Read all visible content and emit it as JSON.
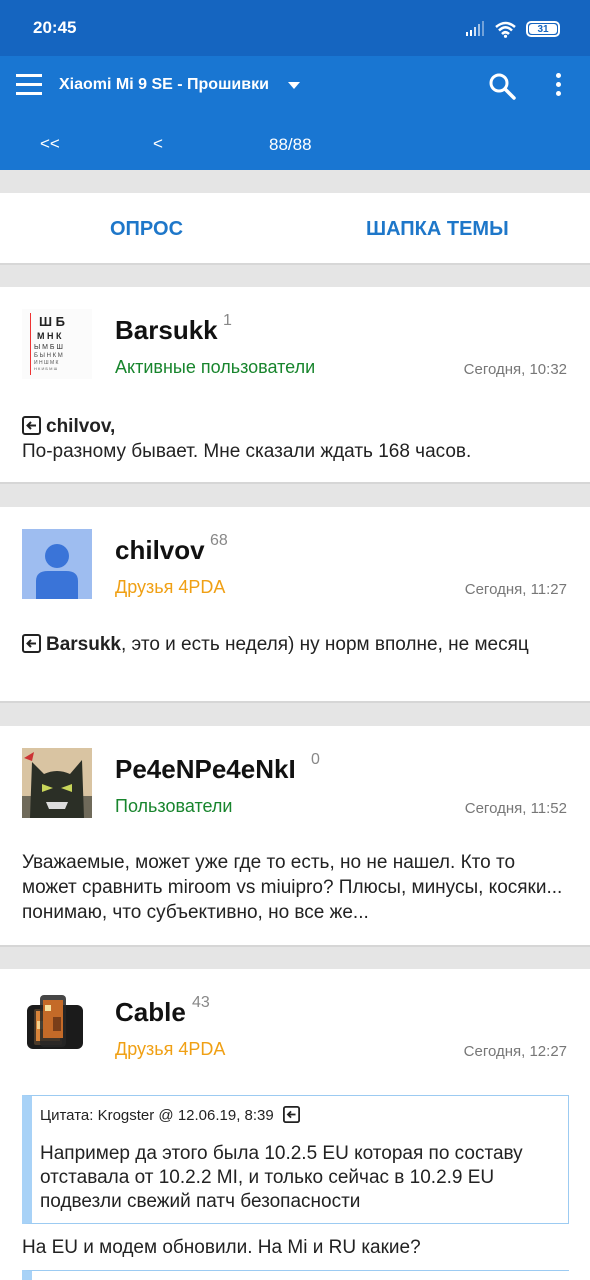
{
  "status": {
    "time": "20:45",
    "battery": "31",
    "icons": [
      "signal-icon",
      "wifi-icon",
      "battery-icon"
    ]
  },
  "app_bar": {
    "title": "Xiaomi Mi 9 SE - Прошивки",
    "icons": [
      "menu-icon",
      "dropdown-caret-icon",
      "search-icon",
      "more-vertical-icon"
    ]
  },
  "pager": {
    "first": "<<",
    "prev": "<",
    "pages": "88/88"
  },
  "actions": {
    "poll": "ОПРОС",
    "topic_header": "ШАПКА ТЕМЫ"
  },
  "posts": [
    {
      "author": "Barsukk",
      "reputation": "1",
      "group": "Активные пользователи",
      "time": "Сегодня, 10:32",
      "reply_to": "chilvov,",
      "text": "По-разному бывает. Мне сказали ждать 168 часов."
    },
    {
      "author": "chilvov",
      "reputation": "68",
      "group": "Друзья 4PDA",
      "time": "Сегодня, 11:27",
      "reply_to": "Barsukk",
      "text": ", это и есть неделя) ну норм вполне, не месяц"
    },
    {
      "author": "Pe4eNPe4eNkI",
      "reputation": "0",
      "group": "Пользователи",
      "time": "Сегодня, 11:52",
      "text": "Уважаемые, может уже где то есть, но не нашел. Кто то может сравнить miroom vs miuipro? Плюсы, минусы, косяки... понимаю, что субъективно, но все же..."
    },
    {
      "author": "Cable",
      "reputation": "43",
      "group": "Друзья 4PDA",
      "time": "Сегодня, 12:27",
      "quote_meta": "Цитата: Krogster @ 12.06.19, 8:39",
      "quote_text": "Например да этого была 10.2.5 EU которая по составу отставала от 10.2.2 MI, и только сейчас в 10.2.9 EU подвезли свежий патч безопасности",
      "text": "На EU и модем обновили. На Mi и RU какие?"
    }
  ],
  "colors": {
    "status_bar": "#1565c0",
    "app_bar": "#1976d2",
    "accent_link": "#1e77c9",
    "group_green": "#18852d",
    "group_orange": "#f0a014"
  }
}
